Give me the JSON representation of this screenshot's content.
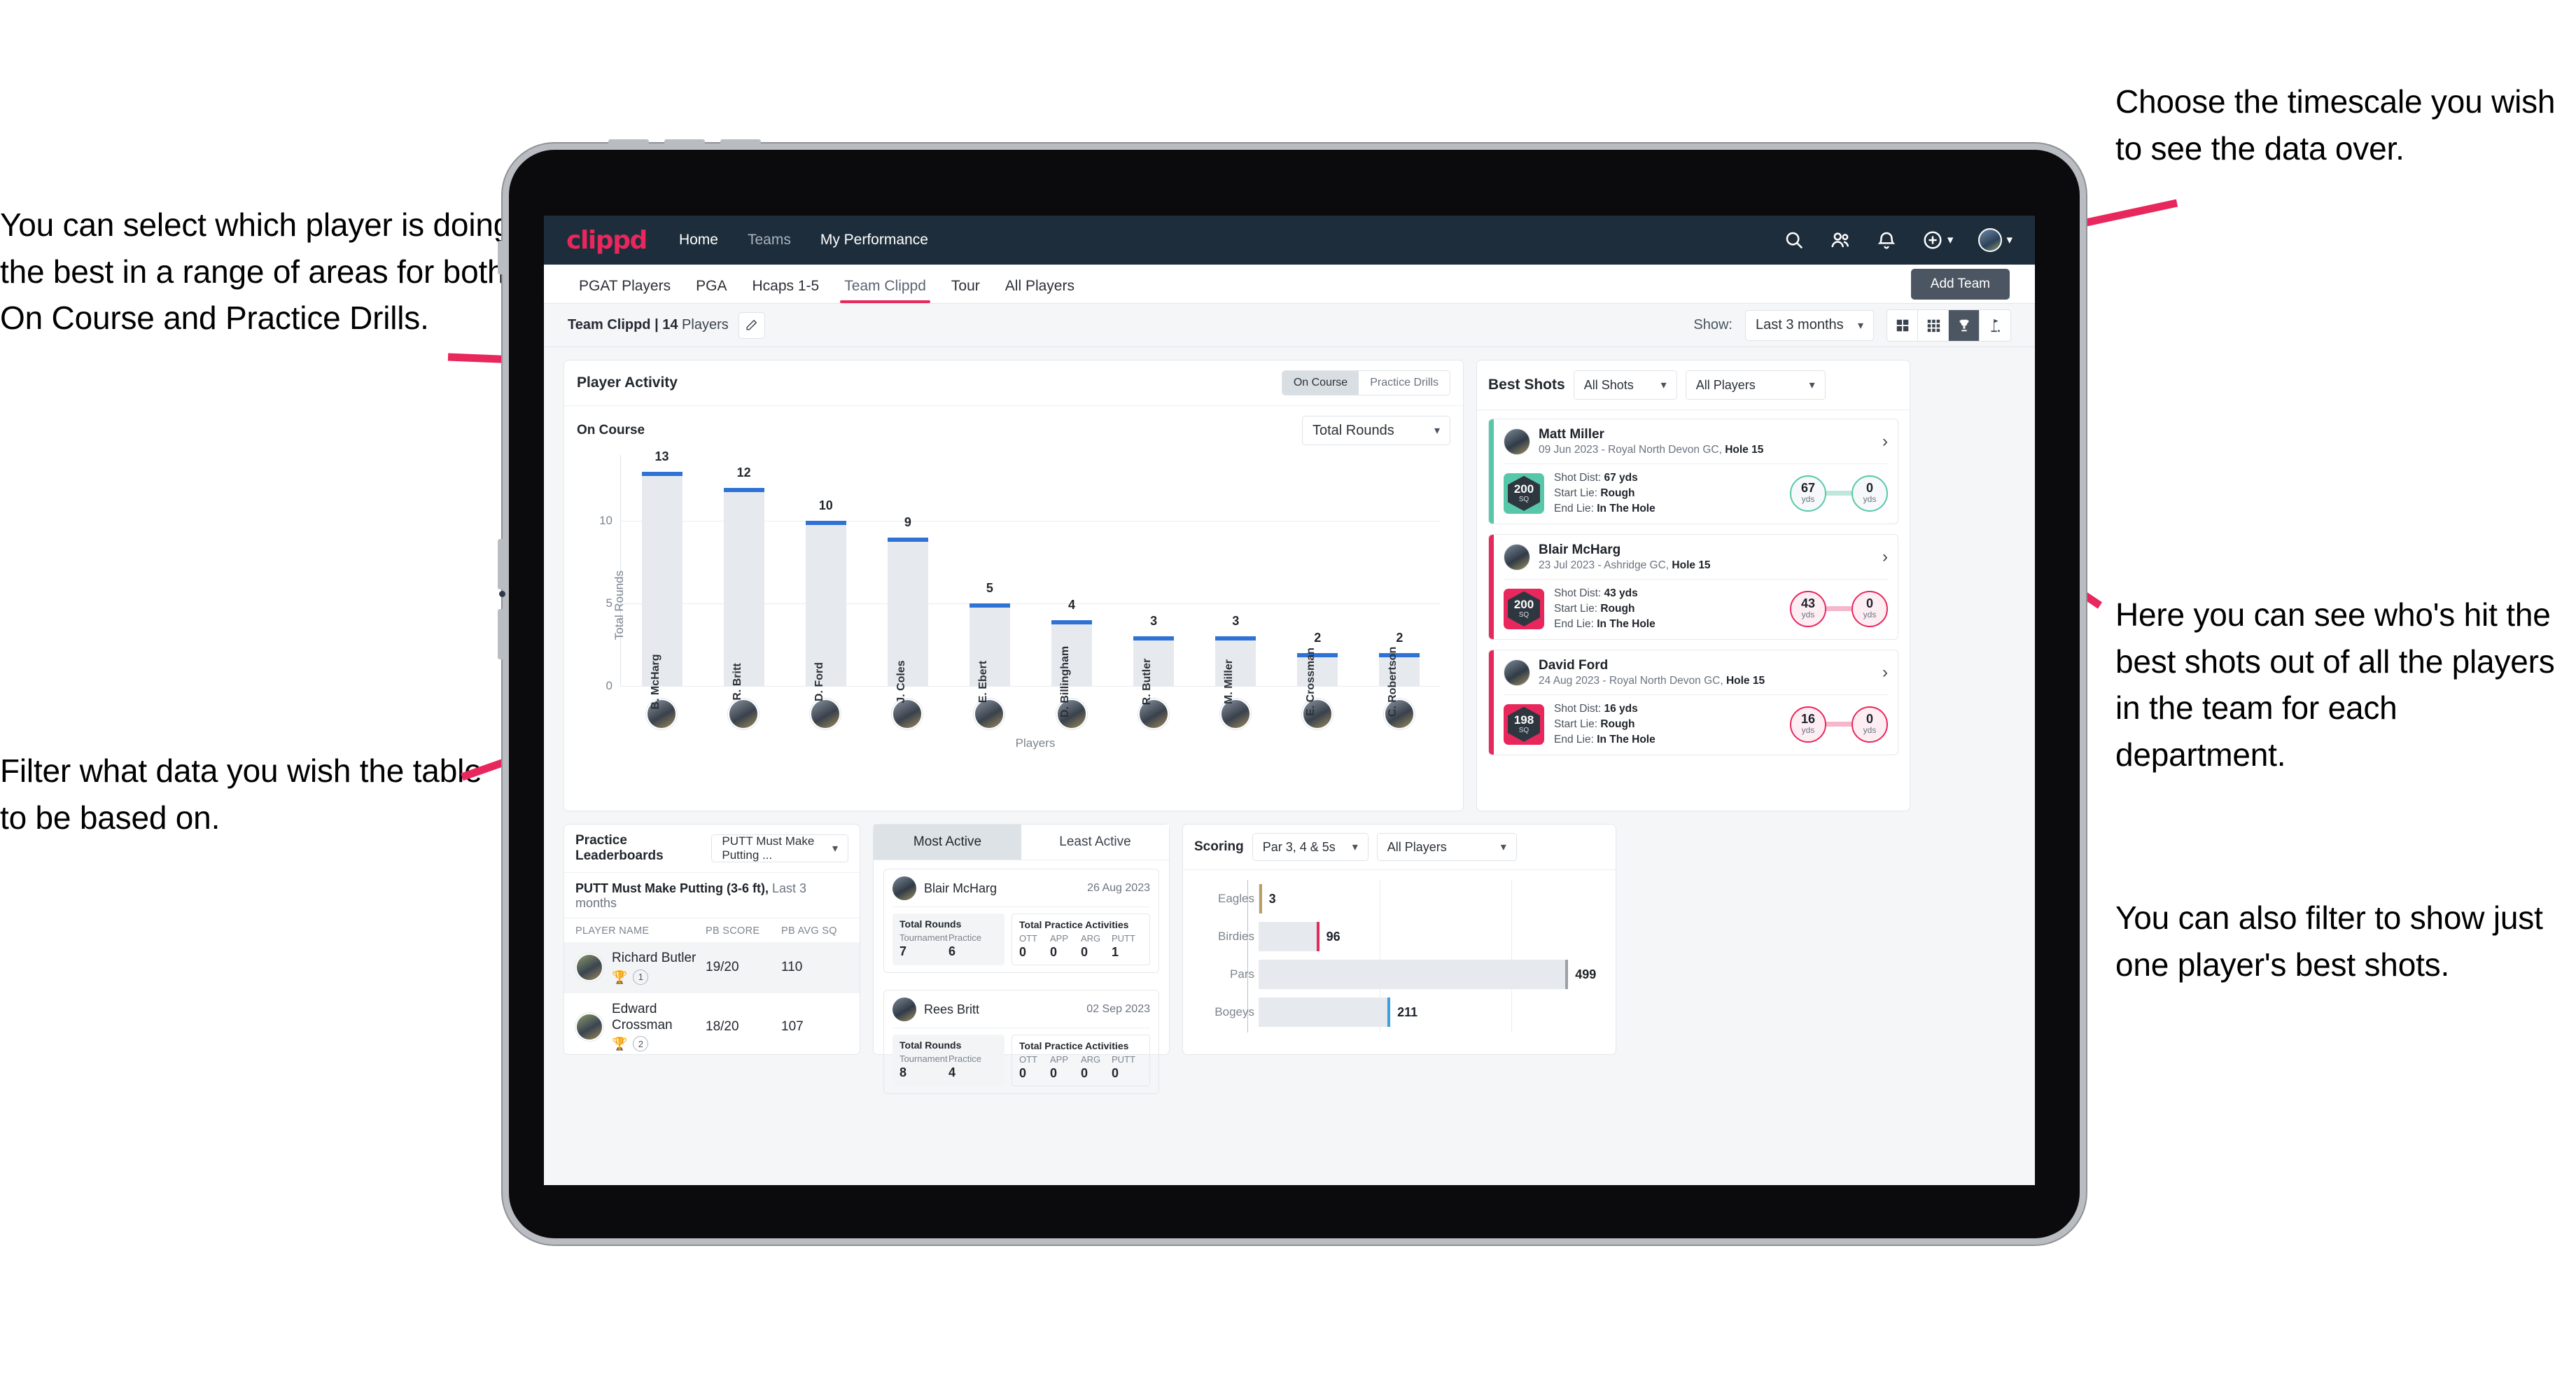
{
  "annotations": {
    "top_left": "You can select which player is doing the best in a range of areas for both On Course and Practice Drills.",
    "bottom_left": "Filter what data you wish the table to be based on.",
    "top_right": "Choose the timescale you wish to see the data over.",
    "right_1": "Here you can see who's hit the best shots out of all the players in the team for each department.",
    "right_2": "You can also filter to show just one player's best shots."
  },
  "app": {
    "logo": "clippd",
    "nav": [
      {
        "label": "Home",
        "active": true
      },
      {
        "label": "Teams",
        "active": false
      },
      {
        "label": "My Performance",
        "active": true
      }
    ],
    "icons": {
      "search": "search-icon",
      "people": "people-icon",
      "bell": "bell-icon",
      "plus": "plus-circle-icon",
      "avatar": "user-avatar"
    },
    "tabs": [
      {
        "label": "PGAT Players",
        "active": false
      },
      {
        "label": "PGA",
        "active": false
      },
      {
        "label": "Hcaps 1-5",
        "active": false
      },
      {
        "label": "Team Clippd",
        "active": true
      },
      {
        "label": "Tour",
        "active": false
      },
      {
        "label": "All Players",
        "active": false
      }
    ],
    "add_team_button": "Add Team",
    "subheader": {
      "team_name": "Team Clippd",
      "separator": " | ",
      "player_count": "14",
      "player_word": " Players",
      "show_label": "Show:",
      "period_value": "Last 3 months",
      "view_icons": [
        {
          "name": "grid-large-icon",
          "active": false
        },
        {
          "name": "grid-small-icon",
          "active": false
        },
        {
          "name": "trophy-icon",
          "active": true
        },
        {
          "name": "golf-flag-icon",
          "active": false
        }
      ]
    }
  },
  "player_activity": {
    "title": "Player Activity",
    "segments": [
      {
        "label": "On Course",
        "active": true
      },
      {
        "label": "Practice Drills",
        "active": false
      }
    ],
    "sub_label": "On Course",
    "metric_select": "Total Rounds"
  },
  "chart_data": {
    "type": "bar",
    "title": "Player Activity - On Course",
    "xlabel": "Players",
    "ylabel": "Total Rounds",
    "ylim": [
      0,
      14
    ],
    "yticks": [
      0,
      5,
      10
    ],
    "grid": true,
    "categories": [
      "B. McHarg",
      "R. Britt",
      "D. Ford",
      "J. Coles",
      "E. Ebert",
      "D. Billingham",
      "R. Butler",
      "M. Miller",
      "E. Crossman",
      "C. Robertson"
    ],
    "values": [
      13,
      12,
      10,
      9,
      5,
      4,
      3,
      3,
      2,
      2
    ],
    "bar_color": "#e6e9ee",
    "cap_color": "#2f72d6"
  },
  "best_shots": {
    "title": "Best Shots",
    "shot_filter": "All Shots",
    "player_filter": "All Players",
    "items": [
      {
        "name": "Matt Miller",
        "meta_prefix": "09 Jun 2023 - Royal North Devon GC, ",
        "hole": "Hole 15",
        "sq_value": "200",
        "sq_unit": "SQ",
        "accent": "teal",
        "shot_dist_label": "Shot Dist: ",
        "shot_dist": "67 yds",
        "start_lie_label": "Start Lie: ",
        "start_lie": "Rough",
        "end_lie_label": "End Lie: ",
        "end_lie": "In The Hole",
        "from_value": "67",
        "from_unit": "yds",
        "to_value": "0",
        "to_unit": "yds"
      },
      {
        "name": "Blair McHarg",
        "meta_prefix": "23 Jul 2023 - Ashridge GC, ",
        "hole": "Hole 15",
        "sq_value": "200",
        "sq_unit": "SQ",
        "accent": "pink",
        "shot_dist_label": "Shot Dist: ",
        "shot_dist": "43 yds",
        "start_lie_label": "Start Lie: ",
        "start_lie": "Rough",
        "end_lie_label": "End Lie: ",
        "end_lie": "In The Hole",
        "from_value": "43",
        "from_unit": "yds",
        "to_value": "0",
        "to_unit": "yds"
      },
      {
        "name": "David Ford",
        "meta_prefix": "24 Aug 2023 - Royal North Devon GC, ",
        "hole": "Hole 15",
        "sq_value": "198",
        "sq_unit": "SQ",
        "accent": "pink",
        "shot_dist_label": "Shot Dist: ",
        "shot_dist": "16 yds",
        "start_lie_label": "Start Lie: ",
        "start_lie": "Rough",
        "end_lie_label": "End Lie: ",
        "end_lie": "In The Hole",
        "from_value": "16",
        "from_unit": "yds",
        "to_value": "0",
        "to_unit": "yds"
      }
    ]
  },
  "practice_leaderboards": {
    "title": "Practice Leaderboards",
    "drill_select": "PUTT Must Make Putting ...",
    "subtitle_bold": "PUTT Must Make Putting (3-6 ft),",
    "subtitle_rest": " Last 3 months",
    "columns": [
      "PLAYER NAME",
      "PB SCORE",
      "PB AVG SQ"
    ],
    "rows": [
      {
        "name": "Richard Butler",
        "rank": "1",
        "trophy": "gold",
        "pb_score": "19/20",
        "pb_avg_sq": "110"
      },
      {
        "name": "Edward Crossman",
        "rank": "2",
        "trophy": "silver",
        "pb_score": "18/20",
        "pb_avg_sq": "107"
      }
    ]
  },
  "activity_panel": {
    "tabs": [
      {
        "label": "Most Active",
        "active": true
      },
      {
        "label": "Least Active",
        "active": false
      }
    ],
    "items": [
      {
        "name": "Blair McHarg",
        "date": "26 Aug 2023",
        "rounds_title": "Total Rounds",
        "rounds_cols": [
          "Tournament",
          "Practice"
        ],
        "rounds_vals": [
          "7",
          "6"
        ],
        "practice_title": "Total Practice Activities",
        "practice_cols": [
          "OTT",
          "APP",
          "ARG",
          "PUTT"
        ],
        "practice_vals": [
          "0",
          "0",
          "0",
          "1"
        ]
      },
      {
        "name": "Rees Britt",
        "date": "02 Sep 2023",
        "rounds_title": "Total Rounds",
        "rounds_cols": [
          "Tournament",
          "Practice"
        ],
        "rounds_vals": [
          "8",
          "4"
        ],
        "practice_title": "Total Practice Activities",
        "practice_cols": [
          "OTT",
          "APP",
          "ARG",
          "PUTT"
        ],
        "practice_vals": [
          "0",
          "0",
          "0",
          "0"
        ]
      }
    ]
  },
  "scoring": {
    "title": "Scoring",
    "par_select": "Par 3, 4 & 5s",
    "player_select": "All Players",
    "chart": {
      "type": "bar",
      "orientation": "horizontal",
      "categories": [
        "Eagles",
        "Birdies",
        "Pars",
        "Bogeys"
      ],
      "values": [
        3,
        96,
        499,
        211
      ],
      "xmax": 560,
      "colors": [
        "#b89f63",
        "#e8275c",
        "#9aa1a9",
        "#3d9fe0"
      ]
    }
  },
  "colors": {
    "accent_pink": "#e8275c",
    "navy": "#1e2d3b",
    "teal": "#56c8a9",
    "blue": "#2f72d6"
  }
}
